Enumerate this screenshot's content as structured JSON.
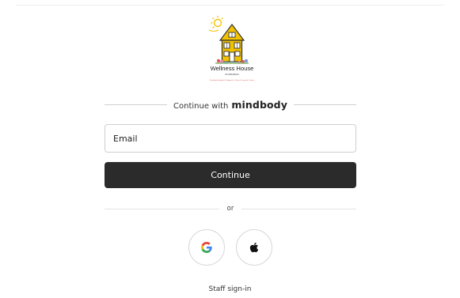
{
  "logo": {
    "name": "Wellness House",
    "sub": "OF ANNAPOLIS",
    "tagline": "Providing Strength & Support for Those Living with Cancer"
  },
  "divider": {
    "prefix": "Continue with",
    "brand": "mindbody"
  },
  "email": {
    "placeholder": "Email",
    "value": ""
  },
  "continue_label": "Continue",
  "or_label": "or",
  "social": {
    "google_icon": "google-icon",
    "apple_icon": "apple-icon"
  },
  "staff_label": "Staff sign-in",
  "colors": {
    "button_bg": "#2b2b2b",
    "button_text": "#ffffff",
    "tagline_red": "#d9534f",
    "house_yellow": "#f2c200"
  }
}
